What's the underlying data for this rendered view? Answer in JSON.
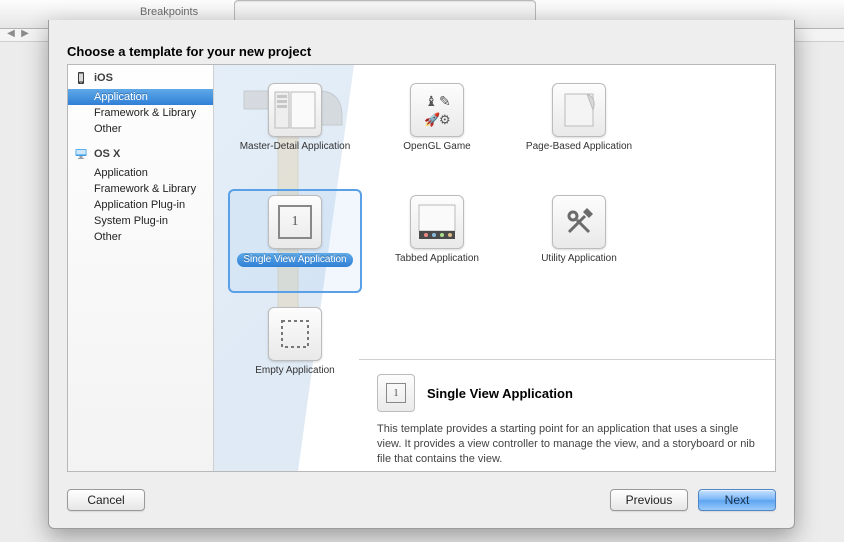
{
  "toolbar": {
    "tab": "Breakpoints"
  },
  "dialog": {
    "heading": "Choose a template for your new project",
    "sidebar": {
      "sections": [
        {
          "title": "iOS",
          "items": [
            "Application",
            "Framework & Library",
            "Other"
          ],
          "selected": 0
        },
        {
          "title": "OS X",
          "items": [
            "Application",
            "Framework & Library",
            "Application Plug-in",
            "System Plug-in",
            "Other"
          ]
        }
      ]
    },
    "templates": [
      {
        "name": "Master-Detail Application",
        "icon": "master-detail"
      },
      {
        "name": "OpenGL Game",
        "icon": "opengl"
      },
      {
        "name": "Page-Based Application",
        "icon": "page"
      },
      {
        "name": "Single View Application",
        "icon": "single",
        "selected": true
      },
      {
        "name": "Tabbed Application",
        "icon": "tabbed"
      },
      {
        "name": "Utility Application",
        "icon": "utility"
      },
      {
        "name": "Empty Application",
        "icon": "empty"
      }
    ],
    "description": {
      "title": "Single View Application",
      "text": "This template provides a starting point for an application that uses a single view. It provides a view controller to manage the view, and a storyboard or nib file that contains the view."
    },
    "buttons": {
      "cancel": "Cancel",
      "previous": "Previous",
      "next": "Next"
    }
  }
}
